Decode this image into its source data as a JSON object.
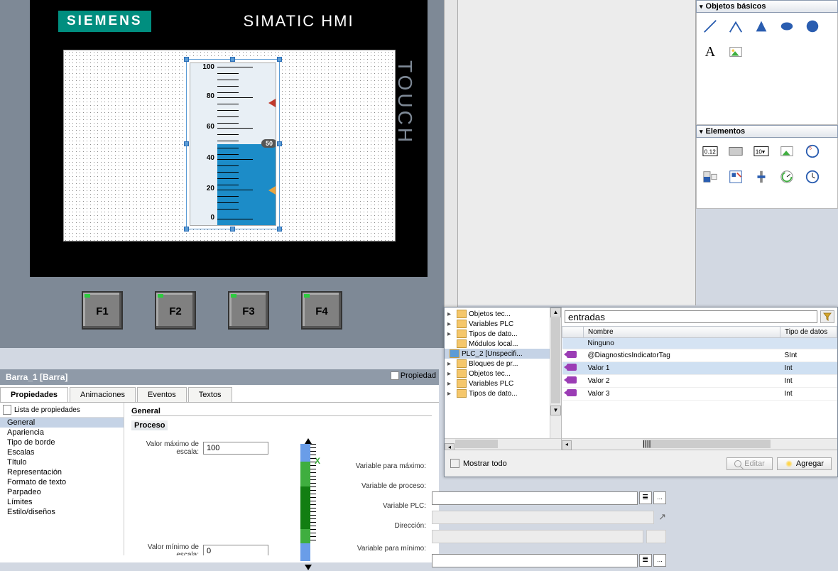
{
  "hmi": {
    "brand": "SIEMENS",
    "title": "SIMATIC HMI",
    "touch_label": "TOUCH",
    "fkeys": [
      "F1",
      "F2",
      "F3",
      "F4"
    ],
    "gauge": {
      "scale": [
        "100",
        "80",
        "60",
        "40",
        "20",
        "0"
      ],
      "marker_value": "50"
    }
  },
  "selection_title": "Barra_1 [Barra]",
  "props_link": "Propiedad",
  "tabs": [
    "Propiedades",
    "Animaciones",
    "Eventos",
    "Textos"
  ],
  "props_list_header": "Lista de propiedades",
  "props_list": [
    "General",
    "Apariencia",
    "Tipo de borde",
    "Escalas",
    "Título",
    "Representación",
    "Formato de texto",
    "Parpadeo",
    "Límites",
    "Estilo/diseños"
  ],
  "form": {
    "section": "General",
    "subsection": "Proceso",
    "max_label": "Valor máximo de escala:",
    "max_value": "100",
    "min_label": "Valor mínimo de escala:",
    "min_value": "0",
    "x_marker": "X",
    "var_max_label": "Variable para máximo:",
    "var_proc_label": "Variable de proceso:",
    "var_plc_label": "Variable PLC:",
    "dir_label": "Dirección:",
    "var_min_label": "Variable para mínimo:"
  },
  "toolbox": {
    "panel1_title": "Objetos básicos",
    "panel2_title": "Elementos"
  },
  "tag_browser": {
    "tree": [
      {
        "label": "Objetos tec...",
        "indent": 1
      },
      {
        "label": "Variables PLC",
        "indent": 1
      },
      {
        "label": "Tipos de dato...",
        "indent": 1
      },
      {
        "label": "Módulos local...",
        "indent": 1
      },
      {
        "label": "PLC_2 [Unspecifi...",
        "indent": 0,
        "selected": true,
        "expanded": true
      },
      {
        "label": "Bloques de pr...",
        "indent": 1
      },
      {
        "label": "Objetos tec...",
        "indent": 1
      },
      {
        "label": "Variables PLC",
        "indent": 1
      },
      {
        "label": "Tipos de dato...",
        "indent": 1
      }
    ],
    "filter_value": "entradas",
    "columns": [
      "Nombre",
      "Tipo de datos"
    ],
    "rows": [
      {
        "name": "Ninguno",
        "type": "",
        "sel": true
      },
      {
        "name": "@DiagnosticsIndicatorTag",
        "type": "SInt"
      },
      {
        "name": "Valor 1",
        "type": "Int",
        "hi": true
      },
      {
        "name": "Valor 2",
        "type": "Int"
      },
      {
        "name": "Valor 3",
        "type": "Int"
      }
    ],
    "show_all_label": "Mostrar todo",
    "edit_label": "Editar",
    "add_label": "Agregar"
  }
}
